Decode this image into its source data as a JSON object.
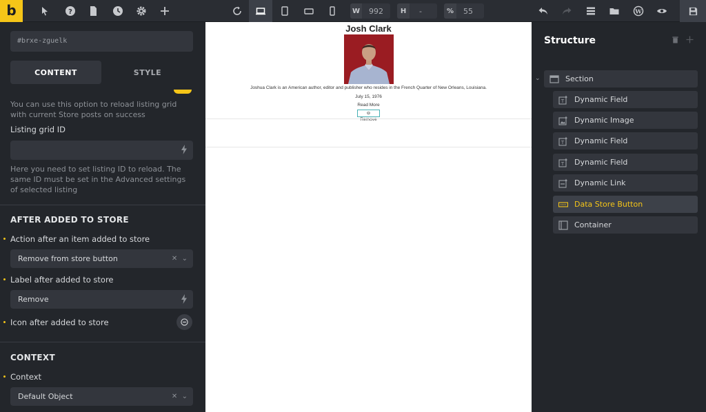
{
  "logo": "b",
  "toolbar": {
    "width_label": "W",
    "width_value": "992",
    "height_label": "H",
    "height_value": "-",
    "zoom_label": "%",
    "zoom_value": "55"
  },
  "left_panel": {
    "element_id": "#brxe-zguelk",
    "tabs": {
      "content": "CONTENT",
      "style": "STYLE"
    },
    "reload_help": "You can use this option to reload listing grid with current Store posts on success",
    "listing_grid_label": "Listing grid ID",
    "listing_grid_value": "",
    "listing_grid_help": "Here you need to set listing ID to reload. The same ID must be set in the Advanced settings of selected listing",
    "after_added_title": "AFTER ADDED TO STORE",
    "action_label": "Action after an item added to store",
    "action_value": "Remove from store button",
    "label_after_label": "Label after added to store",
    "label_after_value": "Remove",
    "icon_after_label": "Icon after added to store",
    "context_title": "CONTEXT",
    "context_label": "Context",
    "context_value": "Default Object"
  },
  "canvas": {
    "title": "Josh Clark",
    "description": "Joshua Clark is an American author, editor and publisher who resides in the French Quarter of New Orleans, Louisiana.",
    "date": "July 15, 1976",
    "read_more": "Read More",
    "remove_button": "⊖ Remove"
  },
  "structure": {
    "title": "Structure",
    "nodes": [
      {
        "label": "Section",
        "icon": "section-icon"
      },
      {
        "label": "Dynamic Field",
        "icon": "dynamic-field-icon"
      },
      {
        "label": "Dynamic Image",
        "icon": "dynamic-image-icon"
      },
      {
        "label": "Dynamic Field",
        "icon": "dynamic-field-icon"
      },
      {
        "label": "Dynamic Field",
        "icon": "dynamic-field-icon"
      },
      {
        "label": "Dynamic Link",
        "icon": "dynamic-link-icon"
      },
      {
        "label": "Data Store Button",
        "icon": "data-store-button-icon"
      },
      {
        "label": "Container",
        "icon": "container-icon"
      }
    ]
  },
  "colors": {
    "accent": "#f5c518",
    "panel_bg": "#23262b",
    "field_bg": "#33363d",
    "button_outline": "#46b0b4"
  }
}
